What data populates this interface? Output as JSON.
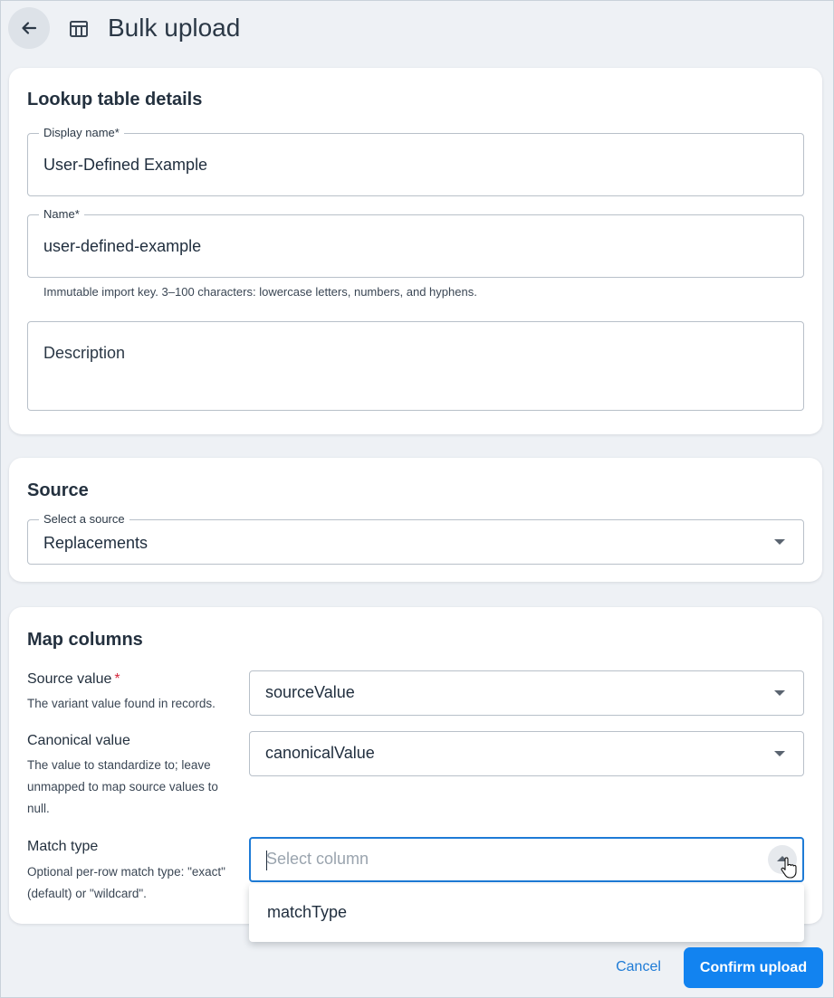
{
  "header": {
    "title": "Bulk upload",
    "back_icon": "arrow-left-icon",
    "table_icon": "table-icon"
  },
  "details": {
    "title": "Lookup table details",
    "display_name": {
      "label": "Display name",
      "required": "*",
      "value": "User-Defined Example"
    },
    "name": {
      "label": "Name",
      "required": "*",
      "value": "user-defined-example",
      "helper": "Immutable import key. 3–100 characters: lowercase letters, numbers, and hyphens."
    },
    "description": {
      "placeholder": "Description"
    }
  },
  "source": {
    "title": "Source",
    "select_label": "Select a source",
    "selected": "Replacements"
  },
  "map": {
    "title": "Map columns",
    "rows": [
      {
        "label": "Source value",
        "required": "*",
        "description": "The variant value found in records.",
        "value": "sourceValue"
      },
      {
        "label": "Canonical value",
        "description": "The value to standardize to; leave unmapped to map source values to null.",
        "value": "canonicalValue"
      },
      {
        "label": "Match type",
        "description": "Optional per-row match type: \"exact\" (default) or \"wildcard\".",
        "placeholder": "Select column"
      }
    ],
    "menu_options": [
      "matchType"
    ]
  },
  "footer": {
    "cancel": "Cancel",
    "confirm": "Confirm upload"
  },
  "colors": {
    "accent": "#1283f0",
    "link": "#1e7bd6",
    "required": "#d6293e",
    "background": "#eef1f5"
  }
}
